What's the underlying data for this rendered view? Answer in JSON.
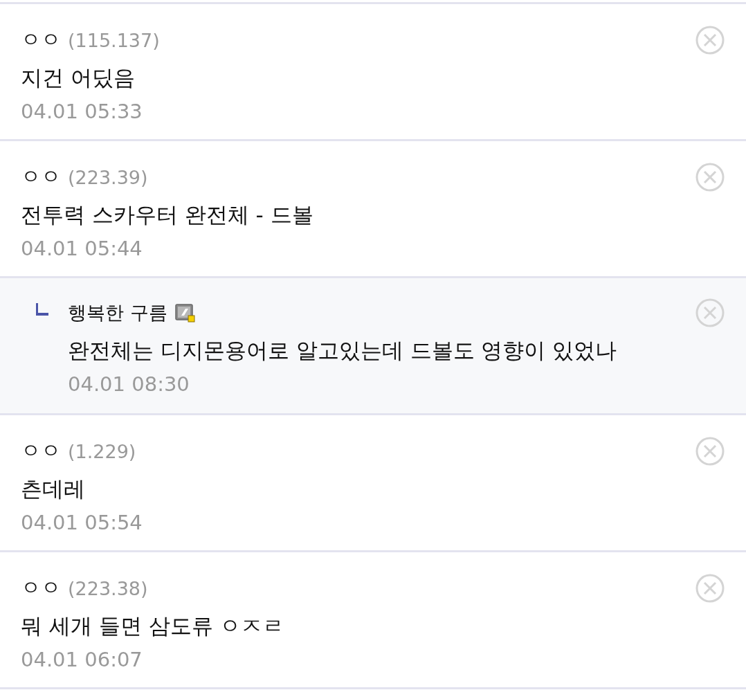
{
  "comments": [
    {
      "kind": "comment",
      "name": "ㅇㅇ",
      "ip": "(115.137)",
      "text": "지건 어딨음",
      "date": "04.01 05:33"
    },
    {
      "kind": "comment",
      "name": "ㅇㅇ",
      "ip": "(223.39)",
      "text": "전투력 스카우터 완전체 - 드볼",
      "date": "04.01 05:44"
    },
    {
      "kind": "reply",
      "name": "행복한 구름",
      "text": "완전체는 디지몬용어로 알고있는데 드볼도 영향이 있었나",
      "date": "04.01 08:30"
    },
    {
      "kind": "comment",
      "name": "ㅇㅇ",
      "ip": "(1.229)",
      "text": "츤데레",
      "date": "04.01 05:54"
    },
    {
      "kind": "comment",
      "name": "ㅇㅇ",
      "ip": "(223.38)",
      "text": "뭐 세개 들면 삼도류 ㅇㅈㄹ",
      "date": "04.01 06:07"
    }
  ]
}
